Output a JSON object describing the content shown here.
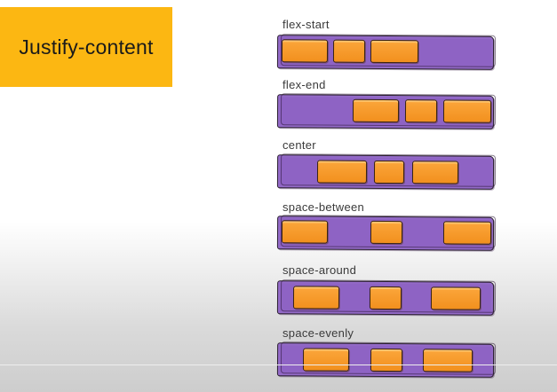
{
  "title": "Justify-content",
  "rows": [
    {
      "label": "flex-start"
    },
    {
      "label": "flex-end"
    },
    {
      "label": "center"
    },
    {
      "label": "space-between"
    },
    {
      "label": "space-around"
    },
    {
      "label": "space-evenly"
    }
  ],
  "colors": {
    "title_bg": "#fcb712",
    "container": "#8e63c4",
    "item": "#f7a02d"
  }
}
